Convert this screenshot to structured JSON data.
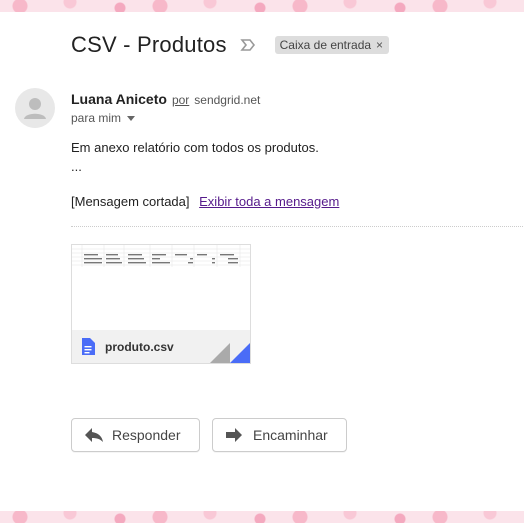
{
  "email": {
    "subject": "CSV - Produtos",
    "label_chip": "Caixa de entrada",
    "chip_close": "×",
    "sender": {
      "name": "Luana Aniceto",
      "via": "por",
      "domain": "sendgrid.net",
      "to": "para mim"
    },
    "body": {
      "line1": "Em anexo relatório com todos os produtos.",
      "line2": "...",
      "trimmed": "[Mensagem cortada]",
      "show_all": "Exibir toda a mensagem"
    },
    "attachment": {
      "file_name": "produto.csv",
      "icon": "doc-icon"
    },
    "actions": {
      "reply": "Responder",
      "forward": "Encaminhar"
    }
  },
  "colors": {
    "accent_blue": "#4a6cf7",
    "link_visited": "#551a8b",
    "theme_pink": "#fbe3ea"
  }
}
